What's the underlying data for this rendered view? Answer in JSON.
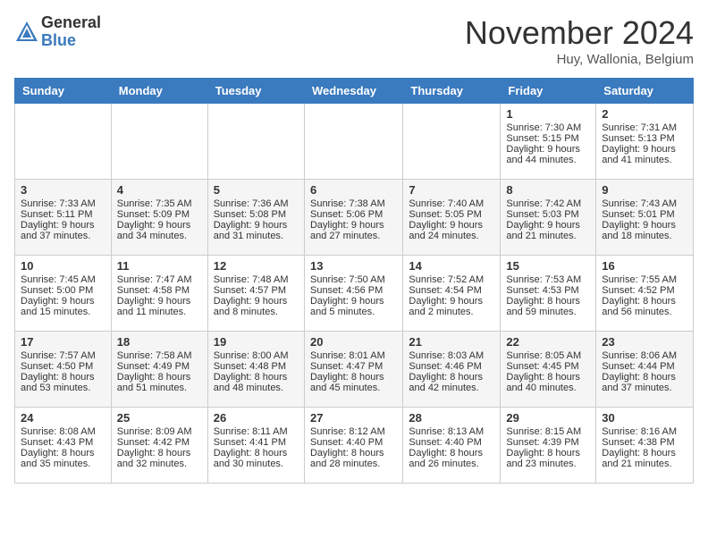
{
  "header": {
    "logo_general": "General",
    "logo_blue": "Blue",
    "month_title": "November 2024",
    "location": "Huy, Wallonia, Belgium"
  },
  "days_of_week": [
    "Sunday",
    "Monday",
    "Tuesday",
    "Wednesday",
    "Thursday",
    "Friday",
    "Saturday"
  ],
  "weeks": [
    [
      {
        "day": "",
        "sunrise": "",
        "sunset": "",
        "daylight": ""
      },
      {
        "day": "",
        "sunrise": "",
        "sunset": "",
        "daylight": ""
      },
      {
        "day": "",
        "sunrise": "",
        "sunset": "",
        "daylight": ""
      },
      {
        "day": "",
        "sunrise": "",
        "sunset": "",
        "daylight": ""
      },
      {
        "day": "",
        "sunrise": "",
        "sunset": "",
        "daylight": ""
      },
      {
        "day": "1",
        "sunrise": "Sunrise: 7:30 AM",
        "sunset": "Sunset: 5:15 PM",
        "daylight": "Daylight: 9 hours and 44 minutes."
      },
      {
        "day": "2",
        "sunrise": "Sunrise: 7:31 AM",
        "sunset": "Sunset: 5:13 PM",
        "daylight": "Daylight: 9 hours and 41 minutes."
      }
    ],
    [
      {
        "day": "3",
        "sunrise": "Sunrise: 7:33 AM",
        "sunset": "Sunset: 5:11 PM",
        "daylight": "Daylight: 9 hours and 37 minutes."
      },
      {
        "day": "4",
        "sunrise": "Sunrise: 7:35 AM",
        "sunset": "Sunset: 5:09 PM",
        "daylight": "Daylight: 9 hours and 34 minutes."
      },
      {
        "day": "5",
        "sunrise": "Sunrise: 7:36 AM",
        "sunset": "Sunset: 5:08 PM",
        "daylight": "Daylight: 9 hours and 31 minutes."
      },
      {
        "day": "6",
        "sunrise": "Sunrise: 7:38 AM",
        "sunset": "Sunset: 5:06 PM",
        "daylight": "Daylight: 9 hours and 27 minutes."
      },
      {
        "day": "7",
        "sunrise": "Sunrise: 7:40 AM",
        "sunset": "Sunset: 5:05 PM",
        "daylight": "Daylight: 9 hours and 24 minutes."
      },
      {
        "day": "8",
        "sunrise": "Sunrise: 7:42 AM",
        "sunset": "Sunset: 5:03 PM",
        "daylight": "Daylight: 9 hours and 21 minutes."
      },
      {
        "day": "9",
        "sunrise": "Sunrise: 7:43 AM",
        "sunset": "Sunset: 5:01 PM",
        "daylight": "Daylight: 9 hours and 18 minutes."
      }
    ],
    [
      {
        "day": "10",
        "sunrise": "Sunrise: 7:45 AM",
        "sunset": "Sunset: 5:00 PM",
        "daylight": "Daylight: 9 hours and 15 minutes."
      },
      {
        "day": "11",
        "sunrise": "Sunrise: 7:47 AM",
        "sunset": "Sunset: 4:58 PM",
        "daylight": "Daylight: 9 hours and 11 minutes."
      },
      {
        "day": "12",
        "sunrise": "Sunrise: 7:48 AM",
        "sunset": "Sunset: 4:57 PM",
        "daylight": "Daylight: 9 hours and 8 minutes."
      },
      {
        "day": "13",
        "sunrise": "Sunrise: 7:50 AM",
        "sunset": "Sunset: 4:56 PM",
        "daylight": "Daylight: 9 hours and 5 minutes."
      },
      {
        "day": "14",
        "sunrise": "Sunrise: 7:52 AM",
        "sunset": "Sunset: 4:54 PM",
        "daylight": "Daylight: 9 hours and 2 minutes."
      },
      {
        "day": "15",
        "sunrise": "Sunrise: 7:53 AM",
        "sunset": "Sunset: 4:53 PM",
        "daylight": "Daylight: 8 hours and 59 minutes."
      },
      {
        "day": "16",
        "sunrise": "Sunrise: 7:55 AM",
        "sunset": "Sunset: 4:52 PM",
        "daylight": "Daylight: 8 hours and 56 minutes."
      }
    ],
    [
      {
        "day": "17",
        "sunrise": "Sunrise: 7:57 AM",
        "sunset": "Sunset: 4:50 PM",
        "daylight": "Daylight: 8 hours and 53 minutes."
      },
      {
        "day": "18",
        "sunrise": "Sunrise: 7:58 AM",
        "sunset": "Sunset: 4:49 PM",
        "daylight": "Daylight: 8 hours and 51 minutes."
      },
      {
        "day": "19",
        "sunrise": "Sunrise: 8:00 AM",
        "sunset": "Sunset: 4:48 PM",
        "daylight": "Daylight: 8 hours and 48 minutes."
      },
      {
        "day": "20",
        "sunrise": "Sunrise: 8:01 AM",
        "sunset": "Sunset: 4:47 PM",
        "daylight": "Daylight: 8 hours and 45 minutes."
      },
      {
        "day": "21",
        "sunrise": "Sunrise: 8:03 AM",
        "sunset": "Sunset: 4:46 PM",
        "daylight": "Daylight: 8 hours and 42 minutes."
      },
      {
        "day": "22",
        "sunrise": "Sunrise: 8:05 AM",
        "sunset": "Sunset: 4:45 PM",
        "daylight": "Daylight: 8 hours and 40 minutes."
      },
      {
        "day": "23",
        "sunrise": "Sunrise: 8:06 AM",
        "sunset": "Sunset: 4:44 PM",
        "daylight": "Daylight: 8 hours and 37 minutes."
      }
    ],
    [
      {
        "day": "24",
        "sunrise": "Sunrise: 8:08 AM",
        "sunset": "Sunset: 4:43 PM",
        "daylight": "Daylight: 8 hours and 35 minutes."
      },
      {
        "day": "25",
        "sunrise": "Sunrise: 8:09 AM",
        "sunset": "Sunset: 4:42 PM",
        "daylight": "Daylight: 8 hours and 32 minutes."
      },
      {
        "day": "26",
        "sunrise": "Sunrise: 8:11 AM",
        "sunset": "Sunset: 4:41 PM",
        "daylight": "Daylight: 8 hours and 30 minutes."
      },
      {
        "day": "27",
        "sunrise": "Sunrise: 8:12 AM",
        "sunset": "Sunset: 4:40 PM",
        "daylight": "Daylight: 8 hours and 28 minutes."
      },
      {
        "day": "28",
        "sunrise": "Sunrise: 8:13 AM",
        "sunset": "Sunset: 4:40 PM",
        "daylight": "Daylight: 8 hours and 26 minutes."
      },
      {
        "day": "29",
        "sunrise": "Sunrise: 8:15 AM",
        "sunset": "Sunset: 4:39 PM",
        "daylight": "Daylight: 8 hours and 23 minutes."
      },
      {
        "day": "30",
        "sunrise": "Sunrise: 8:16 AM",
        "sunset": "Sunset: 4:38 PM",
        "daylight": "Daylight: 8 hours and 21 minutes."
      }
    ]
  ]
}
